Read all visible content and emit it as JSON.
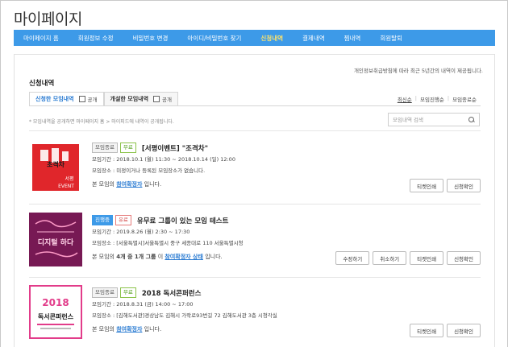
{
  "page": {
    "title": "마이페이지"
  },
  "nav": {
    "items": [
      {
        "label": "마이페이지 홈"
      },
      {
        "label": "회원정보 수정"
      },
      {
        "label": "비밀번호 변경"
      },
      {
        "label": "아이디/비밀번호 찾기"
      },
      {
        "label": "신청내역"
      },
      {
        "label": "결제내역"
      },
      {
        "label": "찜내역"
      },
      {
        "label": "회원탈퇴"
      }
    ],
    "active_index": 4
  },
  "notice": "개인정보취급방침에 따라 최근 5년간의 내역이 제공됩니다.",
  "section_title": "신청내역",
  "tabs": {
    "tab1": {
      "label": "신청한 모임내역",
      "check_label": "공개"
    },
    "tab2": {
      "label": "개설한 모임내역",
      "check_label": "공개"
    }
  },
  "sort": {
    "opt1": "최신순",
    "opt2": "모임진행순",
    "opt3": "모임종료순"
  },
  "helper": "* 모임내역을 공개하면 마이페이지 홈 > 마이피드에 내역이 공개됩니다.",
  "search": {
    "placeholder": "모임내역 검색"
  },
  "items": [
    {
      "status": "모임종료",
      "price": "무료",
      "title": "[서평이벤트] \"조격차\"",
      "period": "모임기간 : 2018.10.1 (월) 11:30 ~ 2018.10.14 (일) 12:00",
      "place": "모임장소 : 미정이거나 등록된 모임장소가 없습니다.",
      "confirm_pre": "본 모임의",
      "confirm_link": "참여확정자",
      "confirm_post": "입니다.",
      "btn_ticket": "티켓인쇄",
      "btn_apply": "신청확인",
      "thumb_text": "초격차",
      "thumb_sub": "서평",
      "thumb_event": "EVENT"
    },
    {
      "status": "진행중",
      "price": "유료",
      "title": "유무료 그룹이 있는 모임 테스트",
      "period": "모임기간 : 2019.8.26 (월) 2:30 ~ 17:30",
      "place": "모임장소 : [서울특별시]서울특별시 중구 세종대로 110 서울특별시청",
      "confirm_pre": "본 모임의",
      "confirm_count": "4개 중 1개 그룹",
      "confirm_mid": "이",
      "confirm_link": "참여확정자 상태",
      "confirm_post": "입니다.",
      "btn_edit": "수정하기",
      "btn_cancel": "취소하기",
      "btn_ticket": "티켓인쇄",
      "btn_apply": "신청확인",
      "thumb_text": "디지털 하다"
    },
    {
      "status": "모임종료",
      "price": "무료",
      "title": "2018 독서콘퍼런스",
      "period": "모임기간 : 2018.8.31 (금) 14:00 ~ 17:00",
      "place": "모임장소 : [김해도서관]경상남도 김해시 가락로93번길 72 김해도서관 3층 시청각실",
      "confirm_pre": "본 모임의",
      "confirm_link": "참여확정자",
      "confirm_post": "입니다.",
      "btn_ticket": "티켓인쇄",
      "btn_apply": "신청확인",
      "thumb_year": "2018",
      "thumb_text": "독서콘퍼런스"
    }
  ],
  "colors": {
    "nav": "#3d9ae8",
    "active_nav": "#ffe36b",
    "link": "#2a7bd2"
  }
}
